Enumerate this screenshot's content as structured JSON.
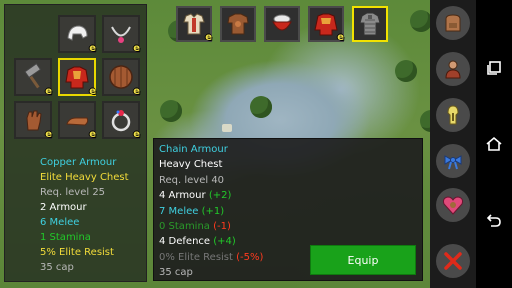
{
  "colors": {
    "cyan": "#3fd0e0",
    "yellow": "#f2dc3a",
    "white": "#ffffff",
    "grey": "#b8b8b8",
    "blue": "#3aa0ff",
    "green": "#22c82a",
    "red": "#ff3a1e",
    "dim_green": "#2a9a2a",
    "dim_grey": "#777777",
    "equip_bg": "#19a21a"
  },
  "equipped_slots": [
    {
      "icon": "tunic-icon",
      "badge": "e"
    },
    {
      "icon": "chest-armor-icon",
      "badge": ""
    },
    {
      "icon": "red-bowl-icon",
      "badge": ""
    },
    {
      "icon": "red-robe-icon",
      "badge": "e"
    },
    {
      "icon": "chain-armor-icon",
      "badge": ""
    }
  ],
  "inventory_slots": [
    {
      "icon": "hood-icon",
      "badge": "e"
    },
    {
      "icon": "necklace-icon",
      "badge": "e"
    },
    {
      "icon": "hammer-icon",
      "badge": "e"
    },
    {
      "icon": "elite-chest-icon",
      "badge": "e"
    },
    {
      "icon": "round-shield-icon",
      "badge": "e"
    },
    {
      "icon": "glove-icon",
      "badge": "e"
    },
    {
      "icon": "boot-icon",
      "badge": "e"
    },
    {
      "icon": "ring-icon",
      "badge": "e"
    }
  ],
  "selected_item": {
    "lines": [
      {
        "text": "Copper Armour",
        "color": "cyan"
      },
      {
        "text": "Elite Heavy Chest",
        "color": "yellow"
      },
      {
        "text": "Req. level 25",
        "color": "grey"
      },
      {
        "text": "2 Armour",
        "color": "white"
      },
      {
        "text": "6 Melee",
        "color": "cyan"
      },
      {
        "text": "1 Stamina",
        "color": "green"
      },
      {
        "text": "5% Elite Resist",
        "color": "yellow"
      },
      {
        "text": "35 cap",
        "color": "grey"
      }
    ]
  },
  "compare_item": {
    "name": "Chain Armour",
    "type": "Heavy Chest",
    "req": "Req. level 40",
    "armour": {
      "base": "4 Armour",
      "diff": "(+2)"
    },
    "melee": {
      "base": "7 Melee",
      "diff": "(+1)"
    },
    "stamina": {
      "base": "0 Stamina",
      "diff": "(-1)"
    },
    "defence": {
      "base": "4 Defence",
      "diff": "(+4)"
    },
    "resist": {
      "base": "0% Elite Resist",
      "diff": "(-5%)"
    },
    "cap": "35 cap"
  },
  "equip_button": {
    "label": "Equip"
  },
  "menu": [
    {
      "icon": "backpack-icon"
    },
    {
      "icon": "character-icon"
    },
    {
      "icon": "keyhole-icon"
    },
    {
      "icon": "blue-ribbon-icon"
    },
    {
      "icon": "heart-icon"
    },
    {
      "icon": "close-icon"
    }
  ],
  "nav": [
    {
      "icon": "recent-apps-icon"
    },
    {
      "icon": "home-icon"
    },
    {
      "icon": "back-icon"
    }
  ]
}
